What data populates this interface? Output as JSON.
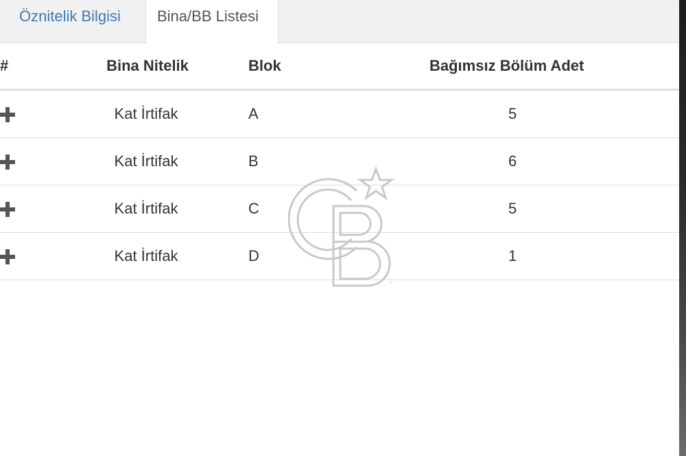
{
  "tabs": [
    {
      "label": "Öznitelik Bilgisi",
      "active": false
    },
    {
      "label": "Bina/BB Listesi",
      "active": true
    }
  ],
  "table": {
    "headers": {
      "hash": "#",
      "nitelik": "Bina Nitelik",
      "blok": "Blok",
      "bb_adet": "Bağımsız Bölüm Adet"
    },
    "rows": [
      {
        "nitelik": "Kat İrtifak",
        "blok": "A",
        "bb_adet": "5"
      },
      {
        "nitelik": "Kat İrtifak",
        "blok": "B",
        "bb_adet": "6"
      },
      {
        "nitelik": "Kat İrtifak",
        "blok": "C",
        "bb_adet": "5"
      },
      {
        "nitelik": "Kat İrtifak",
        "blok": "D",
        "bb_adet": "1"
      }
    ]
  },
  "icons": {
    "row_expand": "plus-icon",
    "watermark": "cb-logo-icon"
  },
  "colors": {
    "tab_link": "#3a7ab7",
    "border": "#dddddd",
    "tabbar_bg": "#f1f1f1",
    "text": "#333333"
  }
}
